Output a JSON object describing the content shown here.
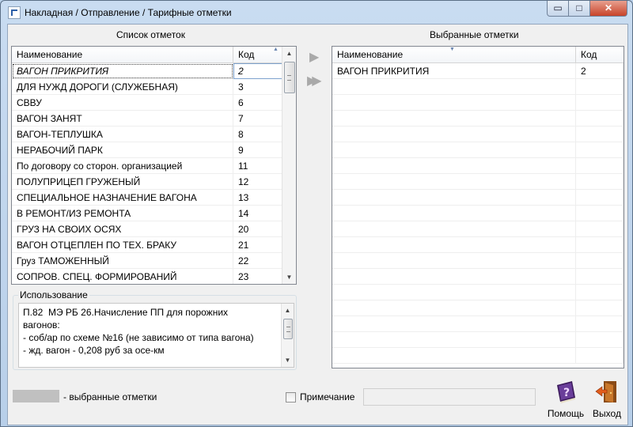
{
  "window": {
    "title": "Накладная / Отправление / Тарифные отметки",
    "min_glyph": "▭",
    "max_glyph": "□",
    "close_glyph": "✕"
  },
  "left_panel": {
    "title": "Список отметок",
    "columns": {
      "name": "Наименование",
      "code": "Код"
    },
    "selected_index": 0,
    "rows": [
      {
        "name": "ВАГОН ПРИКРИТИЯ",
        "code": "2"
      },
      {
        "name": "ДЛЯ НУЖД ДОРОГИ (СЛУЖЕБНАЯ)",
        "code": "3"
      },
      {
        "name": "СВВУ",
        "code": "6"
      },
      {
        "name": "ВАГОН ЗАНЯТ",
        "code": "7"
      },
      {
        "name": "ВАГОН-ТЕПЛУШКА",
        "code": "8"
      },
      {
        "name": "НЕРАБОЧИЙ ПАРК",
        "code": "9"
      },
      {
        "name": "По договору со сторон. организацией",
        "code": "11"
      },
      {
        "name": "ПОЛУПРИЦЕП ГРУЖЕНЫЙ",
        "code": "12"
      },
      {
        "name": "СПЕЦИАЛЬНОЕ НАЗНАЧЕНИЕ ВАГОНА",
        "code": "13"
      },
      {
        "name": "В РЕМОНТ/ИЗ РЕМОНТА",
        "code": "14"
      },
      {
        "name": "ГРУЗ НА СВОИХ ОСЯХ",
        "code": "20"
      },
      {
        "name": "ВАГОН ОТЦЕПЛЕН ПО ТЕХ. БРАКУ",
        "code": "21"
      },
      {
        "name": "Груз ТАМОЖЕННЫЙ",
        "code": "22"
      },
      {
        "name": "СОПРОВ. СПЕЦ. ФОРМИРОВАНИЙ",
        "code": "23"
      }
    ]
  },
  "move_buttons": {
    "add_one": "▶",
    "add_all": "▶▶"
  },
  "right_panel": {
    "title": "Выбранные отметки",
    "columns": {
      "name": "Наименование",
      "code": "Код"
    },
    "rows": [
      {
        "name": "ВАГОН ПРИКРИТИЯ",
        "code": "2"
      }
    ]
  },
  "usage": {
    "label": "Использование",
    "text": "П.82  МЭ РБ 26.Начисление ПП для порожних\nвагонов:\n- соб/ар по схеме №16 (не зависимо от типа вагона)\n- жд. вагон - 0,208 руб за осе-км"
  },
  "legend": {
    "text": "-  выбранные отметки",
    "swatch_color": "#c0c0c0"
  },
  "note": {
    "label": "Примечание",
    "value": ""
  },
  "toolbar": {
    "help_label": "Помощь",
    "exit_label": "Выход"
  },
  "icons": {
    "help": "help-book-icon",
    "exit": "exit-door-icon"
  }
}
